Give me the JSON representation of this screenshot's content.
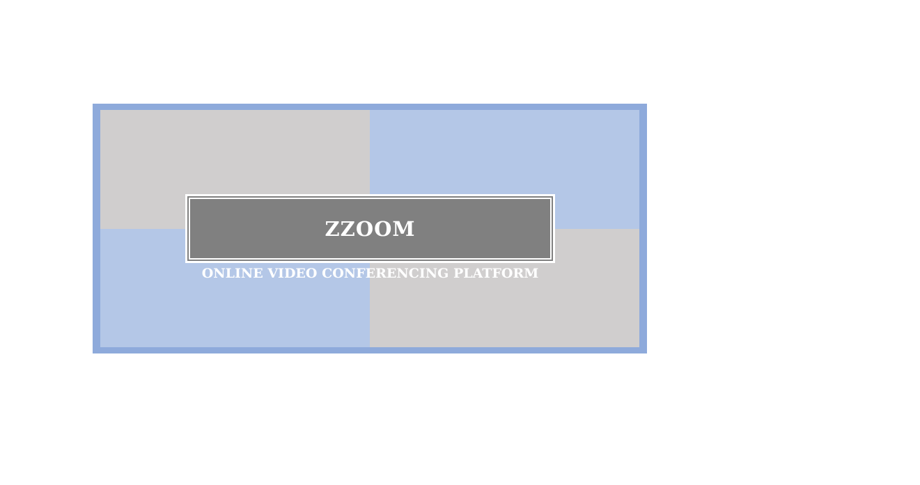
{
  "brand": {
    "name": "ZZOOM",
    "tagline": "ONLINE VIDEO CONFERENCING PLATFORM"
  },
  "colors": {
    "frame": "#8eaadb",
    "tile_gray": "#d0cece",
    "tile_blue": "#b4c7e7",
    "logo_box": "#808080",
    "text": "#ffffff",
    "background": "#ffffff"
  }
}
